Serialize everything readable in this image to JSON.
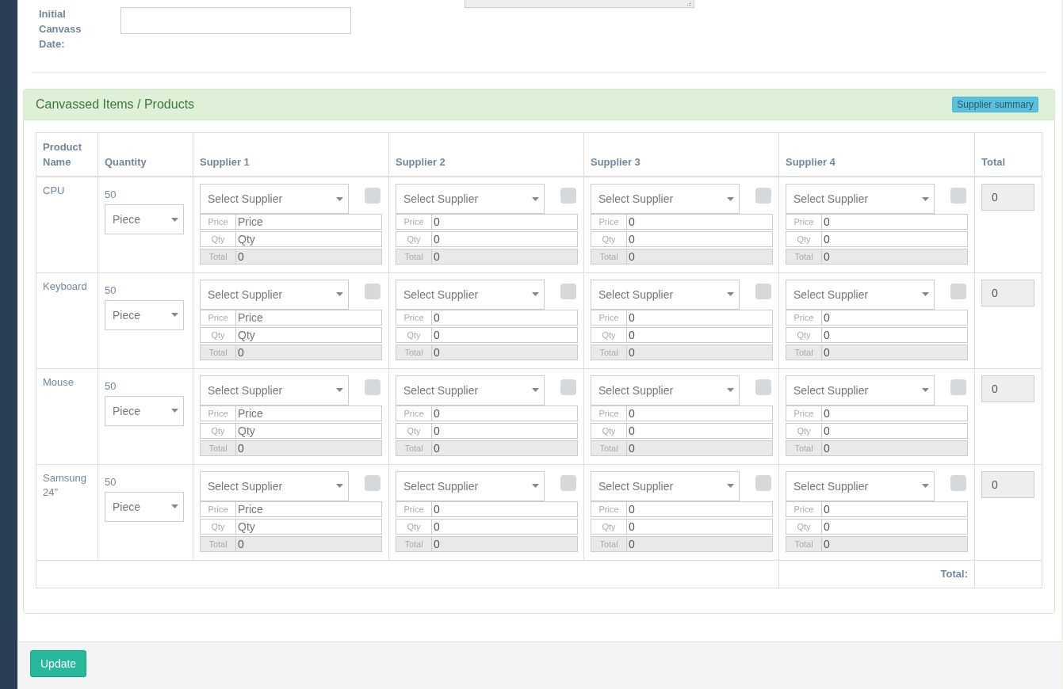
{
  "form": {
    "date_label": "Initial Canvass Date:"
  },
  "panel": {
    "title": "Canvassed Items / Products",
    "summary_button": "Supplier summary"
  },
  "table": {
    "columns": [
      "Product Name",
      "Quantity",
      "Supplier 1",
      "Supplier 2",
      "Supplier 3",
      "Supplier 4",
      "Total"
    ],
    "rows": [
      {
        "product": "CPU",
        "quantity": "50",
        "unit": "Piece",
        "total": "0",
        "suppliers": [
          {
            "select": "Select Supplier",
            "checked": false,
            "fields": [
              {
                "label": "Price",
                "placeholder": "Price",
                "readonly": false
              },
              {
                "label": "Qty",
                "placeholder": "Qty",
                "readonly": false
              },
              {
                "label": "Total",
                "value": "0",
                "readonly": true
              }
            ]
          },
          {
            "select": "Select Supplier",
            "checked": false,
            "fields": [
              {
                "label": "Price",
                "value": "0",
                "readonly": false
              },
              {
                "label": "Qty",
                "value": "0",
                "readonly": false
              },
              {
                "label": "Total",
                "value": "0",
                "readonly": true
              }
            ]
          },
          {
            "select": "Select Supplier",
            "checked": false,
            "fields": [
              {
                "label": "Price",
                "value": "0",
                "readonly": false
              },
              {
                "label": "Qty",
                "value": "0",
                "readonly": false
              },
              {
                "label": "Total",
                "value": "0",
                "readonly": true
              }
            ]
          },
          {
            "select": "Select Supplier",
            "checked": false,
            "fields": [
              {
                "label": "Price",
                "value": "0",
                "readonly": false
              },
              {
                "label": "Qty",
                "value": "0",
                "readonly": false
              },
              {
                "label": "Total",
                "value": "0",
                "readonly": true
              }
            ]
          }
        ]
      },
      {
        "product": "Keyboard",
        "quantity": "50",
        "unit": "Piece",
        "total": "0",
        "suppliers": [
          {
            "select": "Select Supplier",
            "checked": false,
            "fields": [
              {
                "label": "Price",
                "placeholder": "Price",
                "readonly": false
              },
              {
                "label": "Qty",
                "placeholder": "Qty",
                "readonly": false
              },
              {
                "label": "Total",
                "value": "0",
                "readonly": true
              }
            ]
          },
          {
            "select": "Select Supplier",
            "checked": false,
            "fields": [
              {
                "label": "Price",
                "value": "0",
                "readonly": false
              },
              {
                "label": "Qty",
                "value": "0",
                "readonly": false
              },
              {
                "label": "Total",
                "value": "0",
                "readonly": true
              }
            ]
          },
          {
            "select": "Select Supplier",
            "checked": false,
            "fields": [
              {
                "label": "Price",
                "value": "0",
                "readonly": false
              },
              {
                "label": "Qty",
                "value": "0",
                "readonly": false
              },
              {
                "label": "Total",
                "value": "0",
                "readonly": true
              }
            ]
          },
          {
            "select": "Select Supplier",
            "checked": false,
            "fields": [
              {
                "label": "Price",
                "value": "0",
                "readonly": false
              },
              {
                "label": "Qty",
                "value": "0",
                "readonly": false
              },
              {
                "label": "Total",
                "value": "0",
                "readonly": true
              }
            ]
          }
        ]
      },
      {
        "product": "Mouse",
        "quantity": "50",
        "unit": "Piece",
        "total": "0",
        "suppliers": [
          {
            "select": "Select Supplier",
            "checked": false,
            "fields": [
              {
                "label": "Price",
                "placeholder": "Price",
                "readonly": false
              },
              {
                "label": "Qty",
                "placeholder": "Qty",
                "readonly": false
              },
              {
                "label": "Total",
                "value": "0",
                "readonly": true
              }
            ]
          },
          {
            "select": "Select Supplier",
            "checked": false,
            "fields": [
              {
                "label": "Price",
                "value": "0",
                "readonly": false
              },
              {
                "label": "Qty",
                "value": "0",
                "readonly": false
              },
              {
                "label": "Total",
                "value": "0",
                "readonly": true
              }
            ]
          },
          {
            "select": "Select Supplier",
            "checked": false,
            "fields": [
              {
                "label": "Price",
                "value": "0",
                "readonly": false
              },
              {
                "label": "Qty",
                "value": "0",
                "readonly": false
              },
              {
                "label": "Total",
                "value": "0",
                "readonly": true
              }
            ]
          },
          {
            "select": "Select Supplier",
            "checked": false,
            "fields": [
              {
                "label": "Price",
                "value": "0",
                "readonly": false
              },
              {
                "label": "Qty",
                "value": "0",
                "readonly": false
              },
              {
                "label": "Total",
                "value": "0",
                "readonly": true
              }
            ]
          }
        ]
      },
      {
        "product": "Samsung 24\"",
        "quantity": "50",
        "unit": "Piece",
        "total": "0",
        "suppliers": [
          {
            "select": "Select Supplier",
            "checked": false,
            "fields": [
              {
                "label": "Price",
                "placeholder": "Price",
                "readonly": false
              },
              {
                "label": "Qty",
                "placeholder": "Qty",
                "readonly": false
              },
              {
                "label": "Total",
                "value": "0",
                "readonly": true
              }
            ]
          },
          {
            "select": "Select Supplier",
            "checked": false,
            "fields": [
              {
                "label": "Price",
                "value": "0",
                "readonly": false
              },
              {
                "label": "Qty",
                "value": "0",
                "readonly": false
              },
              {
                "label": "Total",
                "value": "0",
                "readonly": true
              }
            ]
          },
          {
            "select": "Select Supplier",
            "checked": false,
            "fields": [
              {
                "label": "Price",
                "value": "0",
                "readonly": false
              },
              {
                "label": "Qty",
                "value": "0",
                "readonly": false
              },
              {
                "label": "Total",
                "value": "0",
                "readonly": true
              }
            ]
          },
          {
            "select": "Select Supplier",
            "checked": false,
            "fields": [
              {
                "label": "Price",
                "value": "0",
                "readonly": false
              },
              {
                "label": "Qty",
                "value": "0",
                "readonly": false
              },
              {
                "label": "Total",
                "value": "0",
                "readonly": true
              }
            ]
          }
        ]
      }
    ],
    "footer_label": "Total:"
  },
  "actions": {
    "update_button": "Update"
  }
}
